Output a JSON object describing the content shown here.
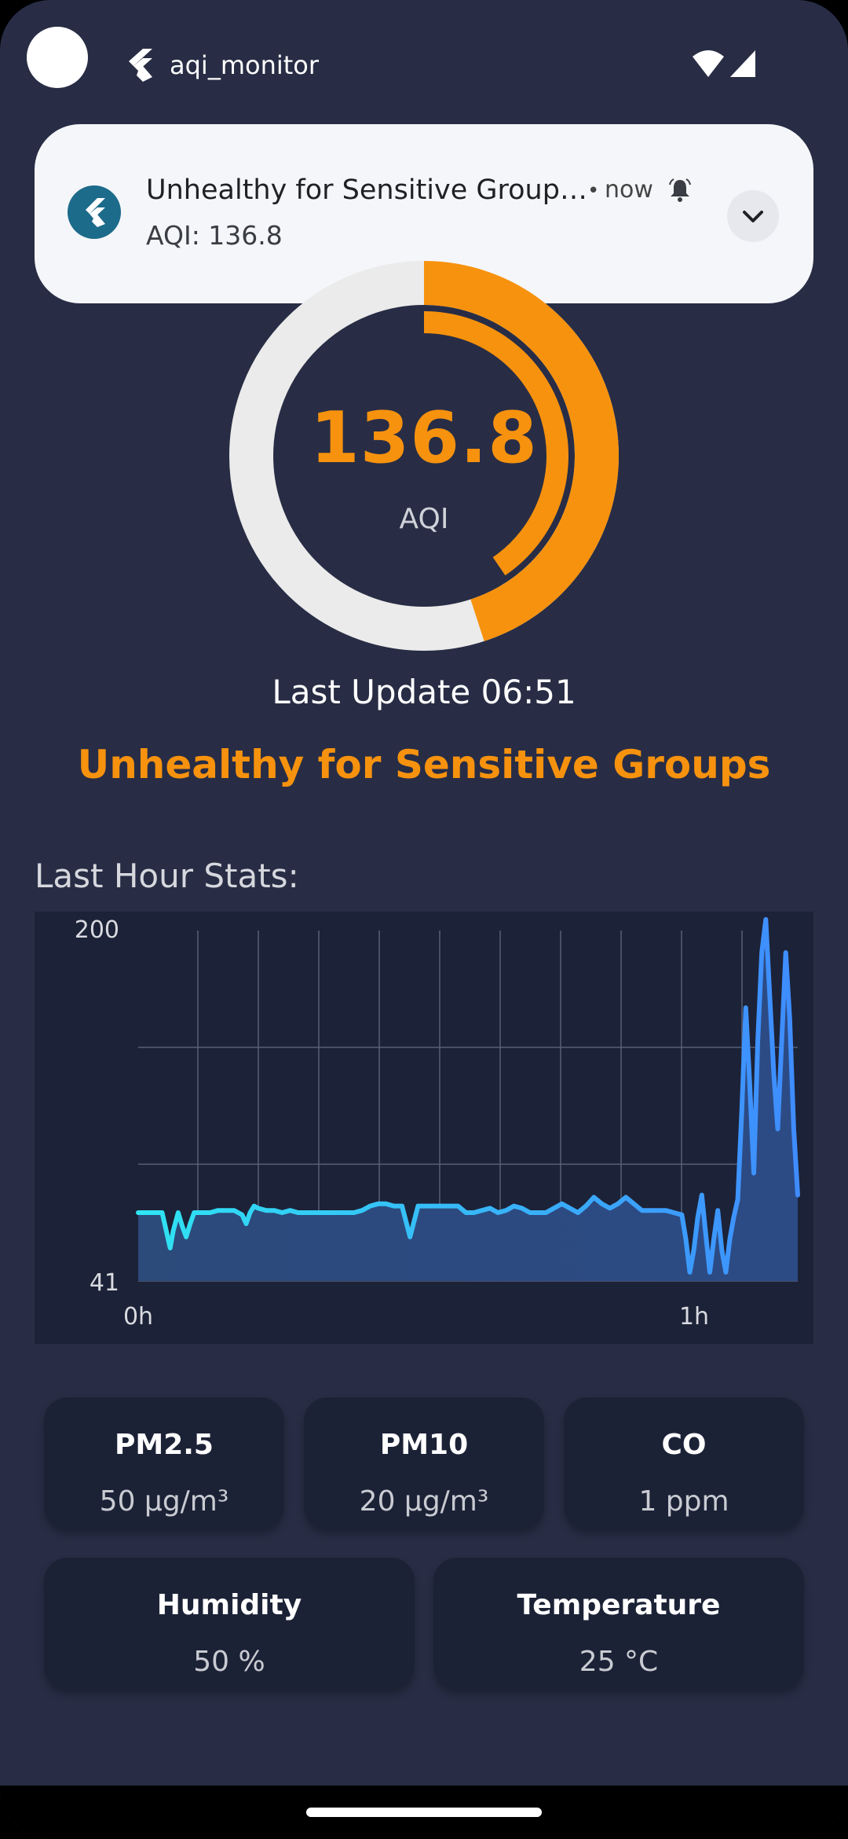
{
  "status_bar": {
    "app_name": "aqi_monitor"
  },
  "notification": {
    "title": "Unhealthy for Sensitive Group…",
    "separator": "•",
    "time": "now",
    "body": "AQI: 136.8"
  },
  "gauge": {
    "value": "136.8",
    "label": "AQI",
    "fraction": 0.45
  },
  "last_update": "Last Update 06:51",
  "category": "Unhealthy for Sensitive Groups",
  "stats_title": "Last Hour Stats:",
  "chart_data": {
    "type": "area",
    "ylim": [
      41,
      200
    ],
    "y_ticks": [
      "200",
      "41"
    ],
    "x_ticks": [
      "0h",
      "1h"
    ],
    "x_tick_values": [
      0,
      60
    ],
    "xlim": [
      0,
      69
    ],
    "series": [
      {
        "values": [
          [
            0,
            72
          ],
          [
            1,
            72
          ],
          [
            2,
            72
          ],
          [
            3,
            72
          ],
          [
            3.5,
            64
          ],
          [
            4,
            56
          ],
          [
            4.4,
            64
          ],
          [
            5,
            72
          ],
          [
            5.5,
            66
          ],
          [
            6,
            61
          ],
          [
            6.5,
            67
          ],
          [
            7,
            72
          ],
          [
            8,
            72
          ],
          [
            9,
            72
          ],
          [
            10,
            73
          ],
          [
            11,
            73
          ],
          [
            12,
            73
          ],
          [
            13,
            71
          ],
          [
            13.5,
            67
          ],
          [
            14,
            72
          ],
          [
            14.5,
            75
          ],
          [
            15,
            74
          ],
          [
            16,
            73
          ],
          [
            17,
            73
          ],
          [
            18,
            72
          ],
          [
            19,
            73
          ],
          [
            20,
            72
          ],
          [
            21,
            72
          ],
          [
            22,
            72
          ],
          [
            23,
            72
          ],
          [
            24,
            72
          ],
          [
            25,
            72
          ],
          [
            26,
            72
          ],
          [
            27,
            72
          ],
          [
            28,
            73
          ],
          [
            29,
            75
          ],
          [
            30,
            76
          ],
          [
            31,
            76
          ],
          [
            32,
            75
          ],
          [
            33,
            75
          ],
          [
            33.5,
            68
          ],
          [
            34,
            61
          ],
          [
            34.5,
            68
          ],
          [
            35,
            75
          ],
          [
            36,
            75
          ],
          [
            37,
            75
          ],
          [
            38,
            75
          ],
          [
            39,
            75
          ],
          [
            40,
            75
          ],
          [
            41,
            72
          ],
          [
            42,
            72
          ],
          [
            43,
            73
          ],
          [
            44,
            74
          ],
          [
            45,
            72
          ],
          [
            46,
            73
          ],
          [
            47,
            75
          ],
          [
            48,
            74
          ],
          [
            49,
            72
          ],
          [
            50,
            72
          ],
          [
            51,
            72
          ],
          [
            52,
            74
          ],
          [
            53,
            76
          ],
          [
            54,
            74
          ],
          [
            55,
            72
          ],
          [
            56,
            75
          ],
          [
            57,
            79
          ],
          [
            58,
            76
          ],
          [
            59,
            74
          ],
          [
            60,
            76
          ],
          [
            61,
            79
          ],
          [
            62,
            76
          ],
          [
            63,
            73
          ],
          [
            64,
            73
          ],
          [
            65,
            73
          ],
          [
            66,
            73
          ],
          [
            67,
            72
          ],
          [
            68,
            71
          ],
          [
            68.5,
            60
          ],
          [
            69,
            45
          ],
          [
            69.5,
            55
          ],
          [
            70,
            70
          ],
          [
            70.5,
            80
          ],
          [
            71,
            62
          ],
          [
            71.5,
            45
          ],
          [
            72,
            60
          ],
          [
            72.5,
            73
          ],
          [
            73,
            55
          ],
          [
            73.5,
            45
          ],
          [
            74,
            60
          ],
          [
            74.5,
            70
          ],
          [
            75,
            78
          ],
          [
            75.5,
            118
          ],
          [
            76,
            165
          ],
          [
            76.5,
            130
          ],
          [
            77,
            90
          ],
          [
            77.5,
            150
          ],
          [
            78,
            190
          ],
          [
            78.5,
            205
          ],
          [
            79,
            170
          ],
          [
            79.5,
            135
          ],
          [
            80,
            110
          ],
          [
            80.5,
            150
          ],
          [
            81,
            190
          ],
          [
            81.5,
            160
          ],
          [
            82,
            110
          ],
          [
            82.5,
            80
          ]
        ]
      }
    ]
  },
  "pollutants": [
    {
      "title": "PM2.5",
      "value": "50 µg/m³"
    },
    {
      "title": "PM10",
      "value": "20 µg/m³"
    },
    {
      "title": "CO",
      "value": "1 ppm"
    }
  ],
  "conditions": [
    {
      "title": "Humidity",
      "value": "50 %"
    },
    {
      "title": "Temperature",
      "value": "25 °C"
    }
  ],
  "colors": {
    "background": "#282d45",
    "accent": "#f7920e",
    "line_start": "#2fe4f2",
    "line_end": "#3f8cff"
  }
}
